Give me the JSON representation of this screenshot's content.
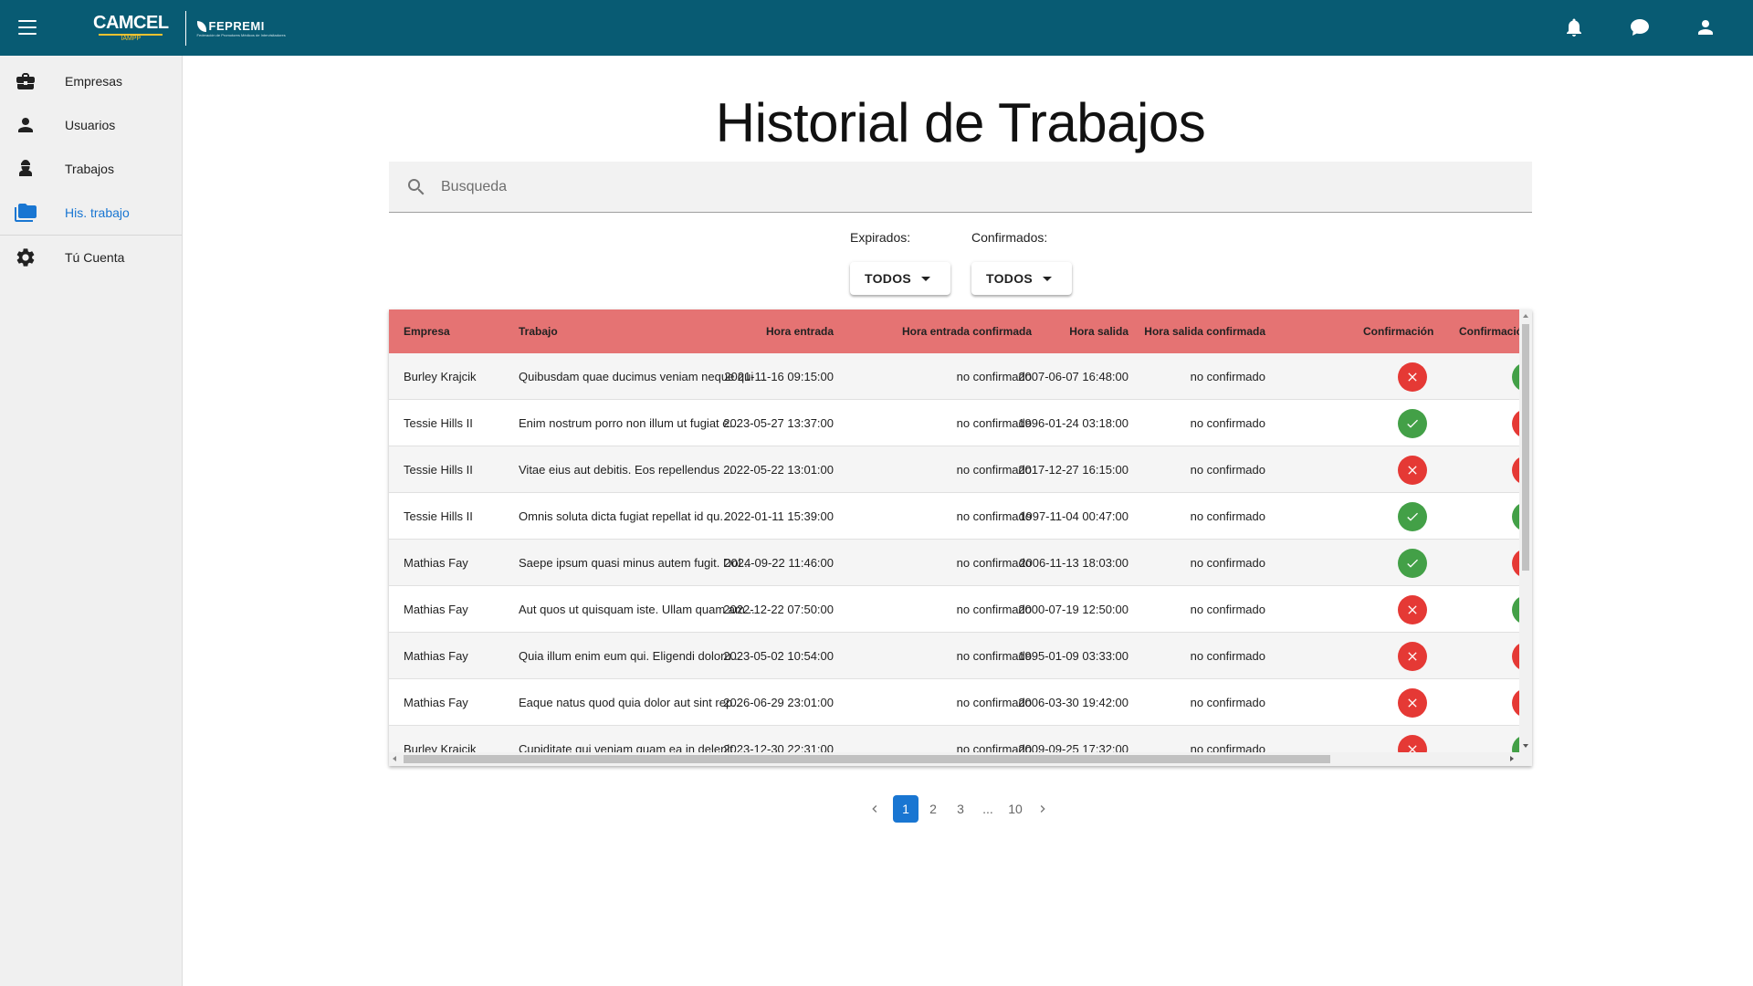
{
  "header": {
    "logo_camcel": "CAMCEL",
    "logo_camcel_sub": "IAMPP",
    "logo_fepremi": "FEPREMI",
    "logo_fepremi_sub": "Federación de Promotores Médicos de Intervisitadores",
    "icons": [
      "menu-icon",
      "bell-icon",
      "chat-icon",
      "account-icon"
    ],
    "brand_color": "#085b73"
  },
  "sidebar": {
    "items": [
      {
        "label": "Empresas",
        "icon": "briefcase-icon"
      },
      {
        "label": "Usuarios",
        "icon": "person-icon"
      },
      {
        "label": "Trabajos",
        "icon": "worker-icon"
      },
      {
        "label": "His. trabajo",
        "icon": "folder-icon",
        "active": true
      },
      {
        "label": "Tú Cuenta",
        "icon": "gear-icon"
      }
    ],
    "active_color": "#1976d2"
  },
  "main": {
    "title": "Historial de Trabajos",
    "search": {
      "placeholder": "Busqueda",
      "value": ""
    },
    "filters": {
      "expirados": {
        "label": "Expirados:",
        "value": "TODOS"
      },
      "confirmados": {
        "label": "Confirmados:",
        "value": "TODOS"
      }
    }
  },
  "table": {
    "header_color": "#e57373",
    "columns": [
      "Empresa",
      "Trabajo",
      "Hora entrada",
      "Hora entrada confirmada",
      "Hora salida",
      "Hora salida confirmada",
      "Confirmación",
      "Confirmació"
    ],
    "rows": [
      {
        "empresa": "Burley Krajcik",
        "trabajo": "Quibusdam quae ducimus veniam neque qui ...",
        "hora_entrada": "2021-11-16 09:15:00",
        "entrada_conf": "no confirmado",
        "hora_salida": "2007-06-07 16:48:00",
        "salida_conf": "no confirmado",
        "confirmacion": "no",
        "confirmacion2": "ok"
      },
      {
        "empresa": "Tessie Hills II",
        "trabajo": "Enim nostrum porro non illum ut fugiat e...",
        "hora_entrada": "2023-05-27 13:37:00",
        "entrada_conf": "no confirmado",
        "hora_salida": "1996-01-24 03:18:00",
        "salida_conf": "no confirmado",
        "confirmacion": "ok",
        "confirmacion2": "no"
      },
      {
        "empresa": "Tessie Hills II",
        "trabajo": "Vitae eius aut debitis. Eos repellendus ...",
        "hora_entrada": "2022-05-22 13:01:00",
        "entrada_conf": "no confirmado",
        "hora_salida": "2017-12-27 16:15:00",
        "salida_conf": "no confirmado",
        "confirmacion": "no",
        "confirmacion2": "no"
      },
      {
        "empresa": "Tessie Hills II",
        "trabajo": "Omnis soluta dicta fugiat repellat id qu...",
        "hora_entrada": "2022-01-11 15:39:00",
        "entrada_conf": "no confirmado",
        "hora_salida": "1997-11-04 00:47:00",
        "salida_conf": "no confirmado",
        "confirmacion": "ok",
        "confirmacion2": "ok"
      },
      {
        "empresa": "Mathias Fay",
        "trabajo": "Saepe ipsum quasi minus autem fugit. Dol...",
        "hora_entrada": "2024-09-22 11:46:00",
        "entrada_conf": "no confirmado",
        "hora_salida": "2006-11-13 18:03:00",
        "salida_conf": "no confirmado",
        "confirmacion": "ok",
        "confirmacion2": "no"
      },
      {
        "empresa": "Mathias Fay",
        "trabajo": "Aut quos ut quisquam iste. Ullam quam am...",
        "hora_entrada": "2022-12-22 07:50:00",
        "entrada_conf": "no confirmado",
        "hora_salida": "2000-07-19 12:50:00",
        "salida_conf": "no confirmado",
        "confirmacion": "no",
        "confirmacion2": "ok"
      },
      {
        "empresa": "Mathias Fay",
        "trabajo": "Quia illum enim eum qui. Eligendi doloru...",
        "hora_entrada": "2023-05-02 10:54:00",
        "entrada_conf": "no confirmado",
        "hora_salida": "1995-01-09 03:33:00",
        "salida_conf": "no confirmado",
        "confirmacion": "no",
        "confirmacion2": "no"
      },
      {
        "empresa": "Mathias Fay",
        "trabajo": "Eaque natus quod quia dolor aut sint rep...",
        "hora_entrada": "2026-06-29 23:01:00",
        "entrada_conf": "no confirmado",
        "hora_salida": "2006-03-30 19:42:00",
        "salida_conf": "no confirmado",
        "confirmacion": "no",
        "confirmacion2": "no"
      },
      {
        "empresa": "Burley Krajcik",
        "trabajo": "Cupiditate qui veniam quam ea in delenit...",
        "hora_entrada": "2023-12-30 22:31:00",
        "entrada_conf": "no confirmado",
        "hora_salida": "2009-09-25 17:32:00",
        "salida_conf": "no confirmado",
        "confirmacion": "no",
        "confirmacion2": "ok"
      }
    ],
    "status_colors": {
      "ok": "#43a047",
      "no": "#e53935"
    }
  },
  "pagination": {
    "pages": [
      "1",
      "2",
      "3",
      "...",
      "10"
    ],
    "current": "1"
  }
}
